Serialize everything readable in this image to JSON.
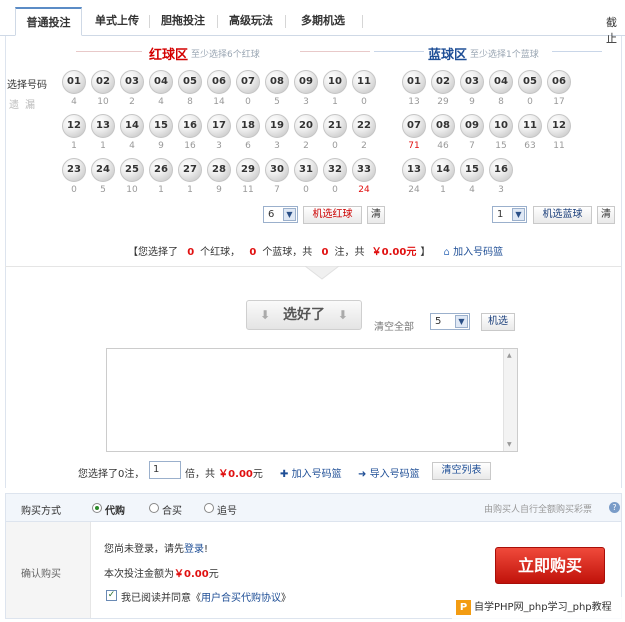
{
  "tabs": [
    {
      "label": "普通投注",
      "active": true
    },
    {
      "label": "单式上传"
    },
    {
      "label": "胆拖投注"
    },
    {
      "label": "高级玩法"
    },
    {
      "label": "多期机选"
    }
  ],
  "deadline_text": "截止",
  "red_zone": {
    "title": "红球区",
    "hint": "至少选择6个红球"
  },
  "blue_zone": {
    "title": "蓝球区",
    "hint": "至少选择1个蓝球"
  },
  "row_labels": {
    "select": "选择号码",
    "miss": "遗漏"
  },
  "red_balls": [
    {
      "n": "01",
      "m": "4"
    },
    {
      "n": "02",
      "m": "10"
    },
    {
      "n": "03",
      "m": "2"
    },
    {
      "n": "04",
      "m": "4"
    },
    {
      "n": "05",
      "m": "8"
    },
    {
      "n": "06",
      "m": "14"
    },
    {
      "n": "07",
      "m": "0"
    },
    {
      "n": "08",
      "m": "5"
    },
    {
      "n": "09",
      "m": "3"
    },
    {
      "n": "10",
      "m": "1"
    },
    {
      "n": "11",
      "m": "0"
    },
    {
      "n": "12",
      "m": "1"
    },
    {
      "n": "13",
      "m": "1"
    },
    {
      "n": "14",
      "m": "4"
    },
    {
      "n": "15",
      "m": "9"
    },
    {
      "n": "16",
      "m": "16"
    },
    {
      "n": "17",
      "m": "3"
    },
    {
      "n": "18",
      "m": "6"
    },
    {
      "n": "19",
      "m": "3"
    },
    {
      "n": "20",
      "m": "2"
    },
    {
      "n": "21",
      "m": "0"
    },
    {
      "n": "22",
      "m": "2"
    },
    {
      "n": "23",
      "m": "0"
    },
    {
      "n": "24",
      "m": "5"
    },
    {
      "n": "25",
      "m": "10"
    },
    {
      "n": "26",
      "m": "1"
    },
    {
      "n": "27",
      "m": "1"
    },
    {
      "n": "28",
      "m": "9"
    },
    {
      "n": "29",
      "m": "11"
    },
    {
      "n": "30",
      "m": "7"
    },
    {
      "n": "31",
      "m": "0"
    },
    {
      "n": "32",
      "m": "0"
    },
    {
      "n": "33",
      "m": "24",
      "hot": true
    }
  ],
  "blue_balls": [
    {
      "n": "01",
      "m": "13"
    },
    {
      "n": "02",
      "m": "29"
    },
    {
      "n": "03",
      "m": "9"
    },
    {
      "n": "04",
      "m": "8"
    },
    {
      "n": "05",
      "m": "0"
    },
    {
      "n": "06",
      "m": "17"
    },
    {
      "n": "07",
      "m": "71",
      "hot": true
    },
    {
      "n": "08",
      "m": "46"
    },
    {
      "n": "09",
      "m": "7"
    },
    {
      "n": "10",
      "m": "15"
    },
    {
      "n": "11",
      "m": "63"
    },
    {
      "n": "12",
      "m": "11"
    },
    {
      "n": "13",
      "m": "24"
    },
    {
      "n": "14",
      "m": "1"
    },
    {
      "n": "15",
      "m": "4"
    },
    {
      "n": "16",
      "m": "3"
    }
  ],
  "red_controls": {
    "count": "6",
    "random_label": "机选红球",
    "clear_label": "清"
  },
  "blue_controls": {
    "count": "1",
    "random_label": "机选蓝球",
    "clear_label": "清"
  },
  "selection_summary": {
    "p1": "【您选择了",
    "red_count": "0",
    "p2": "个红球，",
    "blue_count": "0",
    "p3": "个蓝球，共",
    "bets": "0",
    "p4": "注，共",
    "amount": "￥0.00元",
    "p5": "】",
    "add_basket": "加入号码篮"
  },
  "pick_done_label": "选好了",
  "clear_all_label": "清空全部",
  "random_count": "5",
  "random_label": "机选",
  "bottom_summary": {
    "p1": "您选择了0注，",
    "multiple": "1",
    "p2": "倍，共",
    "amount": "￥0.00",
    "p3": "元",
    "add_basket": "加入号码篮",
    "import_basket": "导入号码篮",
    "clear_list": "清空列表"
  },
  "purchase": {
    "label": "购买方式",
    "options": [
      {
        "label": "代购",
        "checked": true
      },
      {
        "label": "合买"
      },
      {
        "label": "追号"
      }
    ],
    "note": "由购买人自行全额购买彩票"
  },
  "confirm": {
    "label": "确认购买",
    "login_prefix": "您尚未登录，请先",
    "login_link": "登录",
    "login_suffix": "!",
    "amount_prefix": "本次投注金额为",
    "amount": "￥0.00",
    "amount_suffix": "元",
    "agree_prefix": "我已阅读并同意《",
    "agree_link": "用户合买代购协议",
    "agree_suffix": "》",
    "buy_label": "立即购买"
  },
  "watermark": {
    "logo": "P",
    "text": "自学PHP网_php学习_php教程"
  }
}
